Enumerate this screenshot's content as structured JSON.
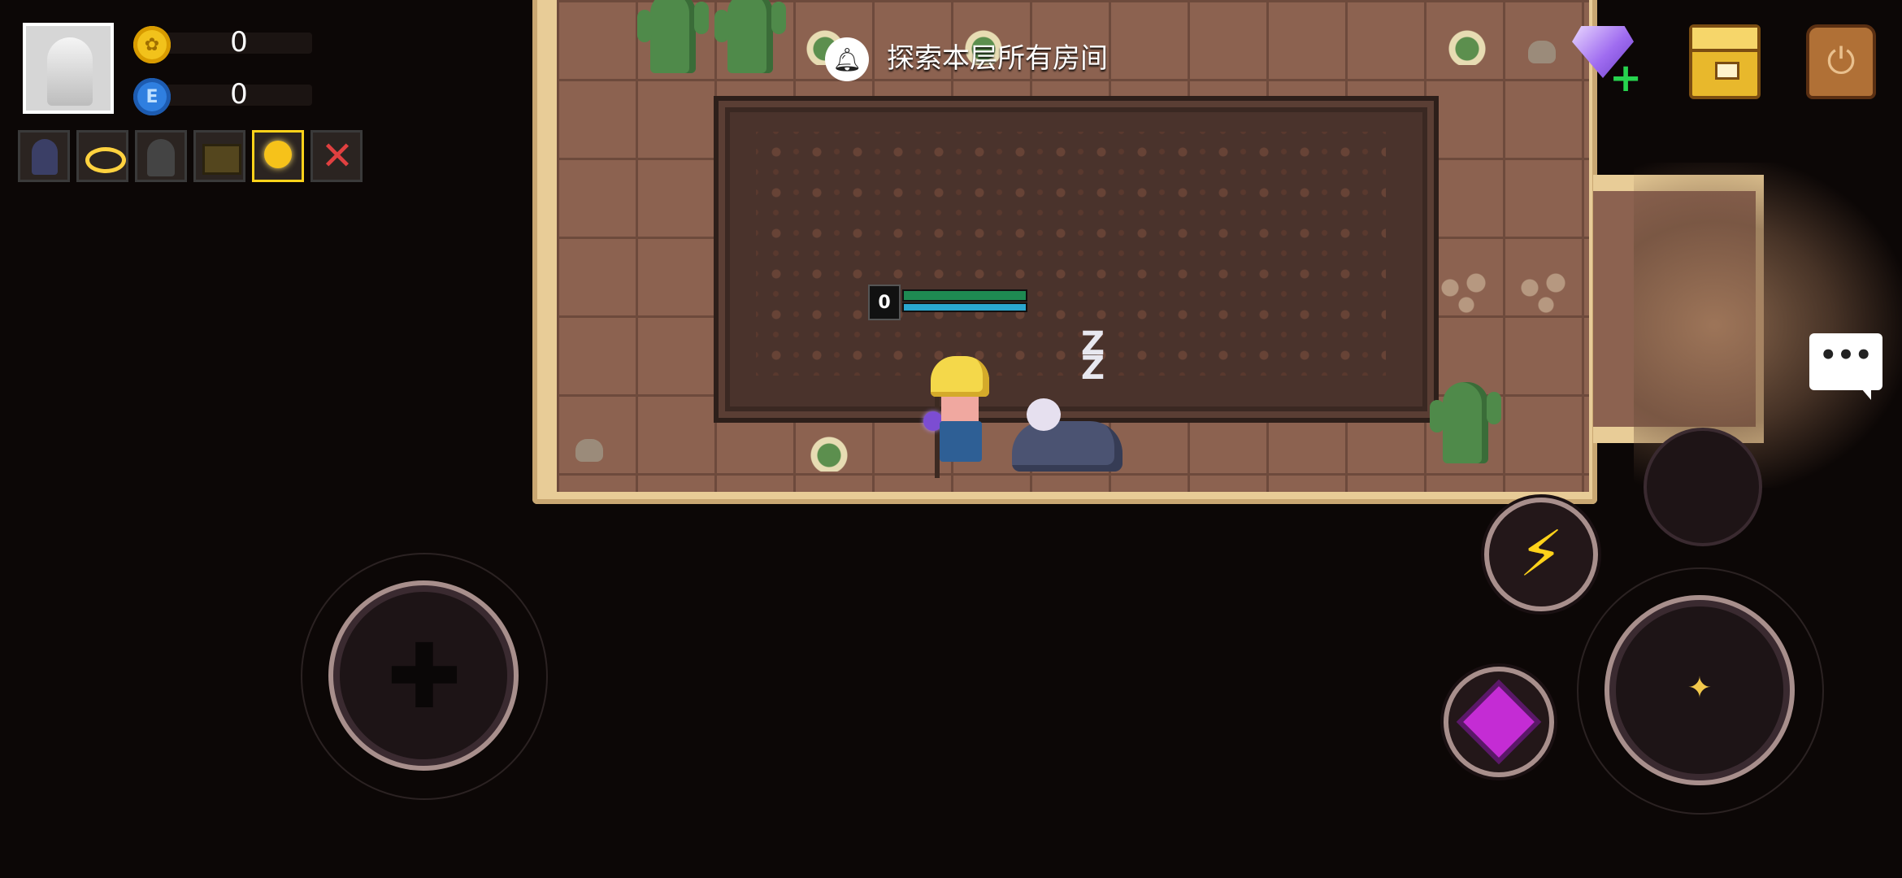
{
  "hud": {
    "gold": {
      "icon": "gold-coin-icon",
      "value": "0"
    },
    "gems": {
      "icon": "blue-gem-icon",
      "value": "0"
    },
    "buffs": [
      {
        "icon": "hooded-hero-buff-icon",
        "active": false
      },
      {
        "icon": "halo-ring-buff-icon",
        "active": false
      },
      {
        "icon": "dark-hood-buff-icon",
        "active": false
      },
      {
        "icon": "treasure-chest-buff-icon",
        "active": false
      },
      {
        "icon": "golden-orb-buff-icon",
        "active": true
      },
      {
        "icon": "crossed-out-buff-icon",
        "active": false
      }
    ]
  },
  "quest": {
    "icon": "bell-icon",
    "text": "探索本层所有房间"
  },
  "player": {
    "level": "0",
    "hp_fraction": 1.0,
    "energy_fraction": 1.0
  },
  "enemy": {
    "state_text": "Z Z"
  },
  "chat": {
    "label": "•••"
  },
  "colors": {
    "sand": "#e8cc97",
    "floor": "#8c6250",
    "carpet": "#4a332c",
    "hp_green": "#1e8a52",
    "energy_blue": "#2aa7cf",
    "skill_ring": "#a88f8c",
    "lightning": "#ffd21a",
    "skill_gem": "#c42cd4"
  }
}
